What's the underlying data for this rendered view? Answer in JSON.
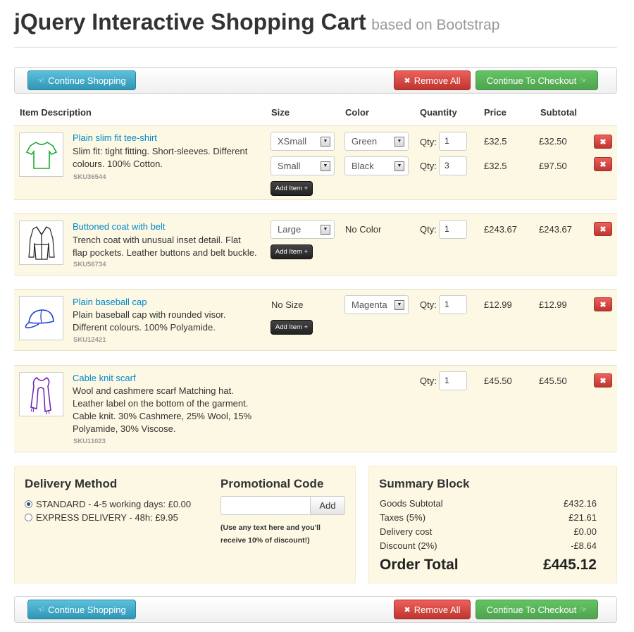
{
  "page": {
    "title": "jQuery Interactive Shopping Cart",
    "subtitle": "based on Bootstrap"
  },
  "toolbar": {
    "continue_label": "Continue Shopping",
    "remove_all_label": "Remove All",
    "checkout_label": "Continue To Checkout",
    "continue_icon": "hand-left-icon",
    "remove_icon": "x-icon",
    "checkout_icon": "hand-right-icon"
  },
  "columns": [
    "Item Description",
    "Size",
    "Color",
    "Quantity",
    "Price",
    "Subtotal"
  ],
  "items": [
    {
      "name": "Plain slim fit tee-shirt",
      "desc": "Slim fit: tight fitting. Short-sleeves. Different colours. 100% Cotton.",
      "sku": "SKU36544",
      "add_label": "Add Item +",
      "qty_label": "Qty:",
      "variants": [
        {
          "size": "XSmall",
          "color": "Green",
          "qty": "1",
          "price": "£32.5",
          "subtotal": "£32.50"
        },
        {
          "size": "Small",
          "color": "Black",
          "qty": "3",
          "price": "£32.5",
          "subtotal": "£97.50"
        }
      ]
    },
    {
      "name": "Buttoned coat with belt",
      "desc": "Trench coat with unusual inset detail. Flat flap pockets. Leather buttons and belt buckle.",
      "sku": "SKU56734",
      "add_label": "Add Item +",
      "qty_label": "Qty:",
      "size": "Large",
      "color": "No Color",
      "qty": "1",
      "price": "£243.67",
      "subtotal": "£243.67"
    },
    {
      "name": "Plain baseball cap",
      "desc": "Plain baseball cap with rounded visor. Different colours. 100% Polyamide.",
      "sku": "SKU12421",
      "add_label": "Add Item +",
      "qty_label": "Qty:",
      "size": "No Size",
      "color": "Magenta",
      "qty": "1",
      "price": "£12.99",
      "subtotal": "£12.99"
    },
    {
      "name": "Cable knit scarf",
      "desc": "Wool and cashmere scarf Matching hat. Leather label on the bottom of the garment. Cable knit. 30% Cashmere, 25% Wool, 15% Polyamide, 30% Viscose.",
      "sku": "SKU11023",
      "qty_label": "Qty:",
      "qty": "1",
      "price": "£45.50",
      "subtotal": "£45.50"
    }
  ],
  "delivery": {
    "title": "Delivery Method",
    "options": [
      "STANDARD - 4-5 working days: £0.00",
      "EXPRESS DELIVERY - 48h: £9.95"
    ],
    "selected_index": 0
  },
  "promo": {
    "title": "Promotional Code",
    "button": "Add",
    "note": "(Use any text here and you'll receive 10% of discount!)"
  },
  "summary": {
    "title": "Summary Block",
    "rows": [
      {
        "label": "Goods Subtotal",
        "value": "£432.16"
      },
      {
        "label": "Taxes (5%)",
        "value": "£21.61"
      },
      {
        "label": "Delivery cost",
        "value": "£0.00"
      },
      {
        "label": "Discount (2%)",
        "value": "-£8.64"
      }
    ],
    "total_label": "Order Total",
    "total_value": "£445.12"
  },
  "colors": {
    "info": "#2f96b4",
    "danger": "#bd362f",
    "success": "#51a351",
    "row_bg": "#fcf8e3",
    "link": "#0088cc"
  }
}
